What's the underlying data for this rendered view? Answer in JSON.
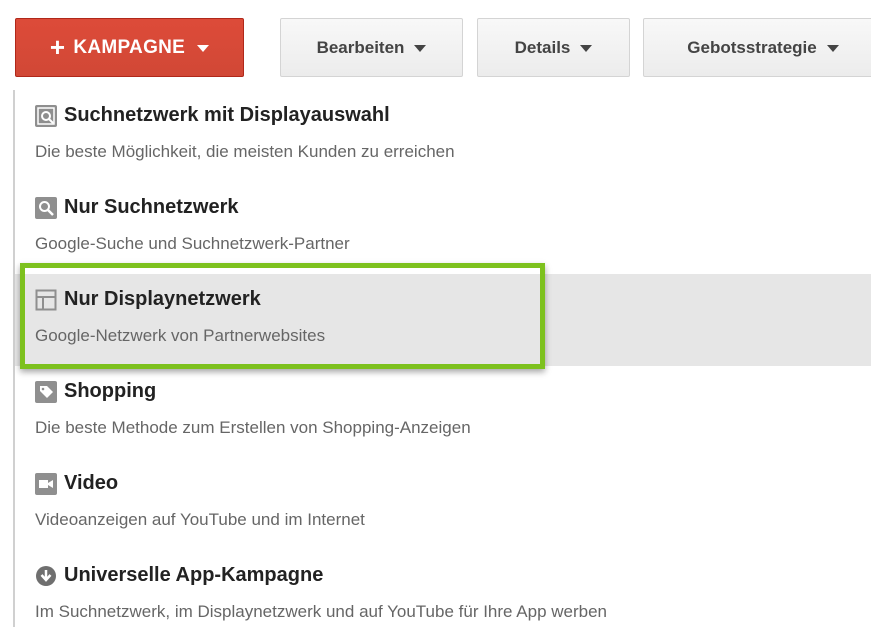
{
  "toolbar": {
    "campaign_label": "KAMPAGNE",
    "edit_label": "Bearbeiten",
    "details_label": "Details",
    "bid_strategy_label": "Gebotsstrategie"
  },
  "menu": {
    "items": [
      {
        "title": "Suchnetzwerk mit Displayauswahl",
        "description": "Die beste Möglichkeit, die meisten Kunden zu erreichen",
        "icon": "search-display-icon"
      },
      {
        "title": "Nur Suchnetzwerk",
        "description": "Google-Suche und Suchnetzwerk-Partner",
        "icon": "search-icon"
      },
      {
        "title": "Nur Displaynetzwerk",
        "description": "Google-Netzwerk von Partnerwebsites",
        "icon": "display-layout-icon",
        "selected": true
      },
      {
        "title": "Shopping",
        "description": "Die beste Methode zum Erstellen von Shopping-Anzeigen",
        "icon": "tag-icon"
      },
      {
        "title": "Video",
        "description": "Videoanzeigen auf YouTube und im Internet",
        "icon": "video-camera-icon"
      },
      {
        "title": "Universelle App-Kampagne",
        "description": "Im Suchnetzwerk, im Displaynetzwerk und auf YouTube für Ihre App werben",
        "icon": "download-icon"
      }
    ]
  },
  "colors": {
    "primary_button": "#d14836",
    "highlight": "#7dc11e",
    "selected_bg": "#e6e6e6",
    "icon_gray": "#8f8f8f"
  }
}
